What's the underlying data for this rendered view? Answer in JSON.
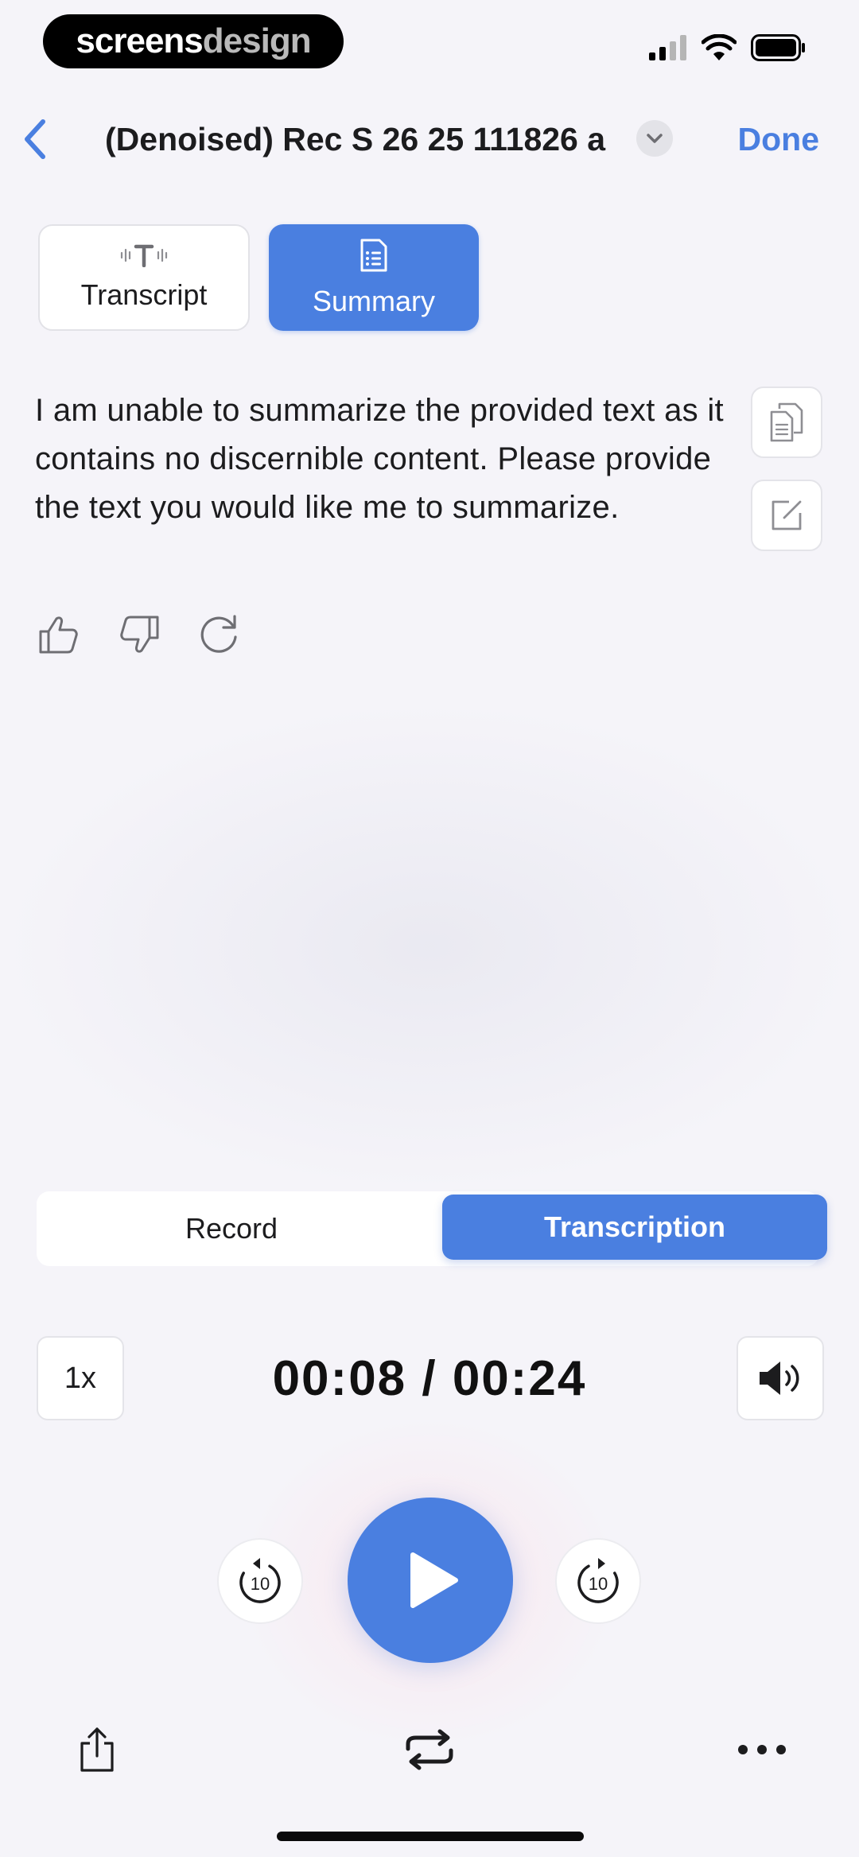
{
  "brand": {
    "part1": "screens",
    "part2": "design"
  },
  "nav": {
    "title": "(Denoised) Rec S 26 25 111826 a",
    "done_label": "Done"
  },
  "tabs": [
    {
      "label": "Transcript",
      "icon": "waveform-text-icon",
      "selected": false
    },
    {
      "label": "Summary",
      "icon": "document-list-icon",
      "selected": true
    }
  ],
  "summary": {
    "text": "I am unable to summarize the provided text as it contains no discernible content. Please provide the text you would like me to summarize."
  },
  "segment": {
    "record_label": "Record",
    "transcription_label": "Transcription",
    "selected": "transcription"
  },
  "player": {
    "speed": "1x",
    "time": "00:08 / 00:24",
    "skip_back_seconds": "10",
    "skip_forward_seconds": "10"
  },
  "colors": {
    "accent": "#4a7fe0",
    "background": "#f5f4f9"
  }
}
